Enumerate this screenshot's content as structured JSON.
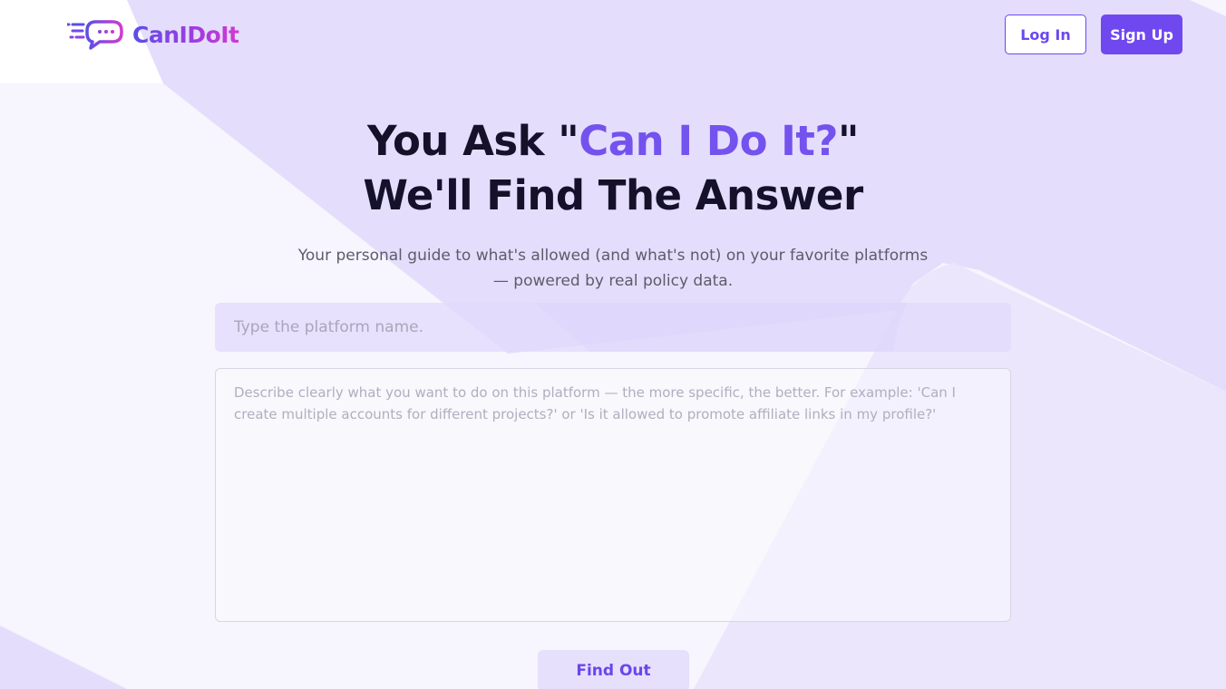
{
  "header": {
    "logo_text": "CanIDoIt",
    "login_label": "Log In",
    "signup_label": "Sign Up"
  },
  "hero": {
    "title_prefix": "You Ask \"",
    "title_accent": "Can I Do It?",
    "title_suffix": "\"",
    "title_line2": "We'll Find The Answer",
    "subtitle_line1": "Your personal guide to what's allowed (and what's not) on your favorite platforms",
    "subtitle_line2": "— powered by real policy data."
  },
  "form": {
    "platform_placeholder": "Type the platform name.",
    "platform_value": "",
    "description_placeholder": "Describe clearly what you want to do on this platform — the more specific, the better. For example: 'Can I create multiple accounts for different projects?' or 'Is it allowed to promote affiliate links in my profile?'",
    "description_value": "",
    "submit_label": "Find Out"
  },
  "colors": {
    "accent": "#7452ee",
    "button_primary": "#7048ef",
    "heading": "#15112b",
    "background_shape": "#e4defc"
  },
  "icons": {
    "logo": "chat-bubble-speed-icon"
  }
}
